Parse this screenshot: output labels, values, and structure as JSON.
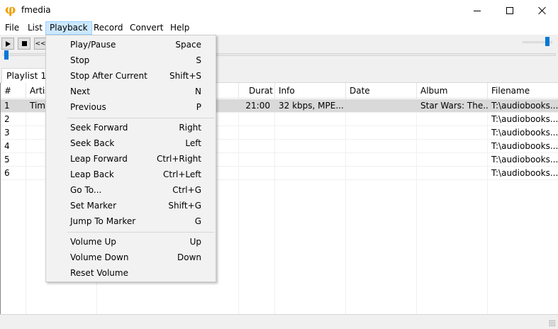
{
  "window": {
    "title": "fmedia",
    "app_icon_glyph": "φ",
    "accent_color": "#0078d7"
  },
  "menubar": {
    "items": [
      {
        "label": "File"
      },
      {
        "label": "List"
      },
      {
        "label": "Playback"
      },
      {
        "label": "Record"
      },
      {
        "label": "Convert"
      },
      {
        "label": "Help"
      }
    ],
    "active": "Playback"
  },
  "toolbar": {
    "play_icon": "play-icon",
    "stop_icon": "stop-icon",
    "prev_label": "<<"
  },
  "tabs": [
    {
      "label": "Playlist 1"
    }
  ],
  "playlist": {
    "columns": [
      {
        "label": "#"
      },
      {
        "label": "Artis"
      },
      {
        "label": ""
      },
      {
        "label": "Durat"
      },
      {
        "label": "Info"
      },
      {
        "label": "Date"
      },
      {
        "label": "Album"
      },
      {
        "label": "Filename"
      }
    ],
    "rows": [
      {
        "num": "1",
        "artist": "Tim",
        "duration": "21:00",
        "info": "32 kbps, MPE...",
        "date": "",
        "album": "Star Wars: The...",
        "filename": "T:\\audiobooks..."
      },
      {
        "num": "2",
        "artist": "",
        "duration": "",
        "info": "",
        "date": "",
        "album": "",
        "filename": "T:\\audiobooks..."
      },
      {
        "num": "3",
        "artist": "",
        "duration": "",
        "info": "",
        "date": "",
        "album": "",
        "filename": "T:\\audiobooks..."
      },
      {
        "num": "4",
        "artist": "",
        "duration": "",
        "info": "",
        "date": "",
        "album": "",
        "filename": "T:\\audiobooks..."
      },
      {
        "num": "5",
        "artist": "",
        "duration": "",
        "info": "",
        "date": "",
        "album": "",
        "filename": "T:\\audiobooks..."
      },
      {
        "num": "6",
        "artist": "",
        "duration": "",
        "info": "",
        "date": "",
        "album": "",
        "filename": "T:\\audiobooks..."
      }
    ]
  },
  "playback_menu": {
    "groups": [
      [
        {
          "label": "Play/Pause",
          "shortcut": "Space"
        },
        {
          "label": "Stop",
          "shortcut": "S"
        },
        {
          "label": "Stop After Current",
          "shortcut": "Shift+S"
        },
        {
          "label": "Next",
          "shortcut": "N"
        },
        {
          "label": "Previous",
          "shortcut": "P"
        }
      ],
      [
        {
          "label": "Seek Forward",
          "shortcut": "Right"
        },
        {
          "label": "Seek Back",
          "shortcut": "Left"
        },
        {
          "label": "Leap Forward",
          "shortcut": "Ctrl+Right"
        },
        {
          "label": "Leap Back",
          "shortcut": "Ctrl+Left"
        },
        {
          "label": "Go To...",
          "shortcut": "Ctrl+G"
        },
        {
          "label": "Set Marker",
          "shortcut": "Shift+G"
        },
        {
          "label": "Jump To Marker",
          "shortcut": "G"
        }
      ],
      [
        {
          "label": "Volume Up",
          "shortcut": "Up"
        },
        {
          "label": "Volume Down",
          "shortcut": "Down"
        },
        {
          "label": "Reset Volume",
          "shortcut": ""
        }
      ]
    ]
  }
}
